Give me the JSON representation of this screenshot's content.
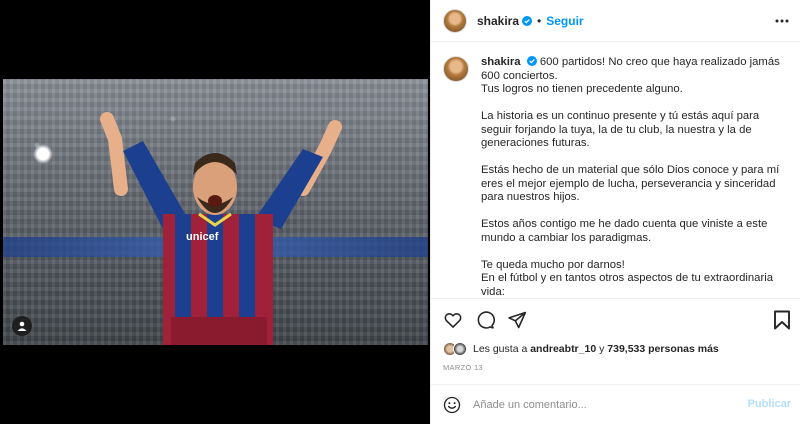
{
  "post": {
    "author": "shakira",
    "follow_label": "Seguir",
    "separator": "•",
    "caption": {
      "paragraphs": [
        "600 partidos! No creo que haya realizado jamás 600 conciertos.\nTus logros no tienen precedente alguno.",
        "La historia es un continuo presente y tú estás aquí para seguir forjando la tuya, la de tu club, la nuestra y la de generaciones futuras.",
        "Estás hecho de un material que sólo Dios conoce y para mí eres el mejor ejemplo de lucha, perseverancia y sinceridad para nuestros hijos.",
        "Estos años contigo me he dado cuenta que viniste a este mundo a cambiar los paradigmas.",
        "Te queda mucho por darnos!\nEn el fútbol y en tantos otros aspectos de tu extraordinaria vida:\nPorque no hay, ni habrá otro Gerard Piqué. Un ser humano"
      ]
    },
    "likes": {
      "prefix": "Les gusta a",
      "user": "andreabtr_10",
      "connector": "y",
      "count": "739,533 personas más"
    },
    "date": "MARZO 13",
    "comment": {
      "placeholder": "Añade un comentario...",
      "publish_label": "Publicar"
    },
    "photo": {
      "jersey_text": "unicef"
    }
  },
  "colors": {
    "accent": "#0095f6",
    "publish_disabled": "#b2dffc",
    "jersey_blue": "#1c3f8f",
    "jersey_red": "#a0213a"
  },
  "icons": [
    "verified-badge-icon",
    "more-options-icon",
    "heart-icon",
    "comment-icon",
    "share-icon",
    "bookmark-icon",
    "emoji-icon",
    "user-tag-icon"
  ]
}
